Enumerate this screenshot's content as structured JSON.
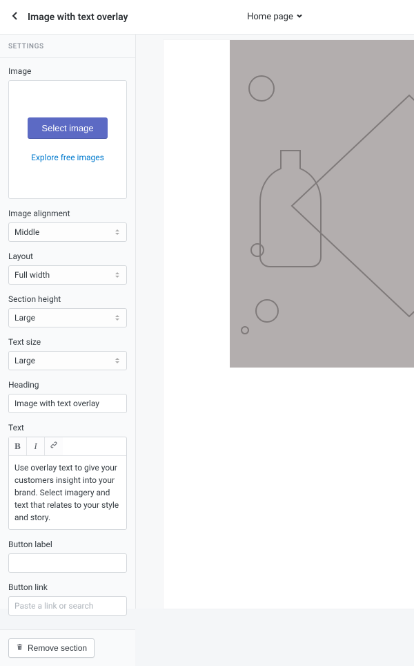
{
  "header": {
    "title": "Image with text overlay",
    "page_selector": "Home page"
  },
  "settings_label": "SETTINGS",
  "image": {
    "label": "Image",
    "select_btn": "Select image",
    "explore_link": "Explore free images"
  },
  "image_alignment": {
    "label": "Image alignment",
    "value": "Middle"
  },
  "layout": {
    "label": "Layout",
    "value": "Full width"
  },
  "section_height": {
    "label": "Section height",
    "value": "Large"
  },
  "text_size": {
    "label": "Text size",
    "value": "Large"
  },
  "heading": {
    "label": "Heading",
    "value": "Image with text overlay"
  },
  "text": {
    "label": "Text",
    "bold_glyph": "B",
    "italic_glyph": "I",
    "value": "Use overlay text to give your customers insight into your brand. Select imagery and text that relates to your style and story."
  },
  "button_label": {
    "label": "Button label",
    "value": ""
  },
  "button_link": {
    "label": "Button link",
    "value": "",
    "placeholder": "Paste a link or search"
  },
  "remove_section": "Remove section"
}
